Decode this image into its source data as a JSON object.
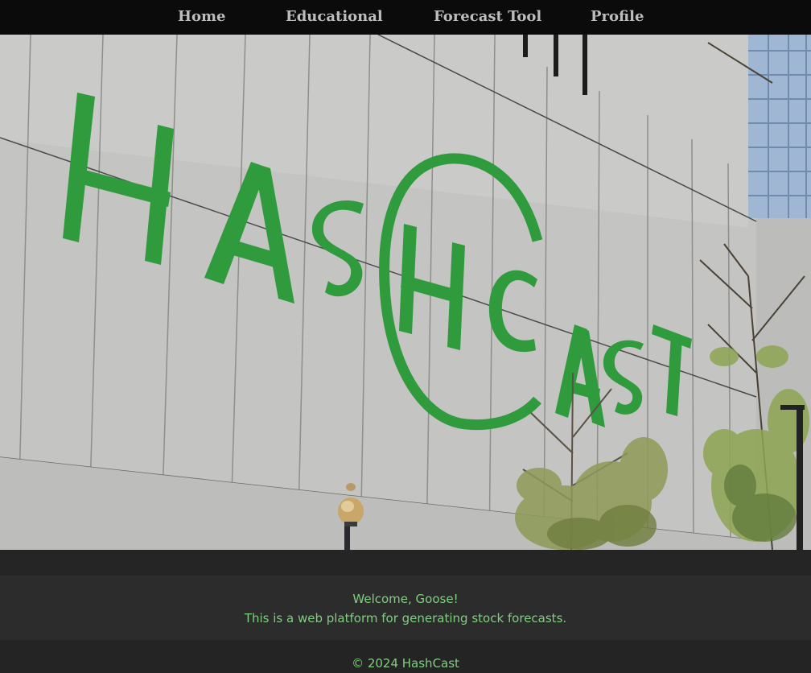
{
  "nav": {
    "items": [
      {
        "label": "Home"
      },
      {
        "label": "Educational"
      },
      {
        "label": "Forecast Tool"
      },
      {
        "label": "Profile"
      }
    ]
  },
  "hero": {
    "sign_text": "HASHCAST",
    "sign_color": "#2e9a3c",
    "wall_color": "#c2c2c0"
  },
  "welcome": {
    "greeting": "Welcome, Goose!",
    "description": "This is a web platform for generating stock forecasts."
  },
  "footer": {
    "copyright": "© 2024 HashCast"
  },
  "colors": {
    "nav_bg": "#0b0b0b",
    "nav_text": "#bdbdbd",
    "page_bg": "#2a2a2a",
    "accent_text": "#7fcf7f"
  }
}
